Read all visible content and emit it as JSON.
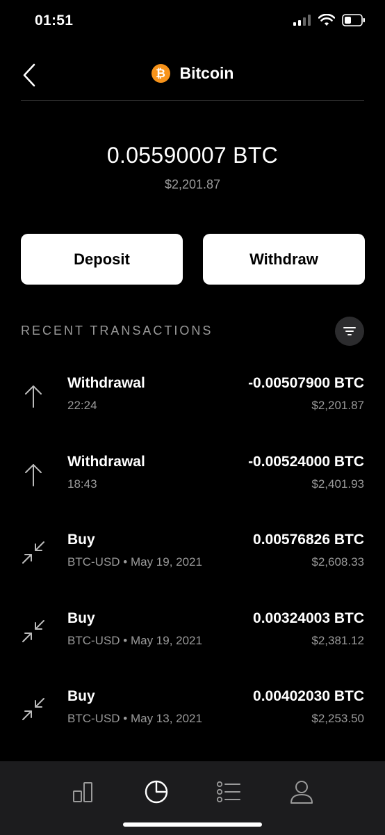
{
  "status": {
    "time": "01:51"
  },
  "header": {
    "title": "Bitcoin",
    "coin_symbol": "₿"
  },
  "balance": {
    "btc": "0.05590007 BTC",
    "usd": "$2,201.87"
  },
  "actions": {
    "deposit_label": "Deposit",
    "withdraw_label": "Withdraw"
  },
  "recent": {
    "title": "RECENT TRANSACTIONS",
    "items": [
      {
        "type": "Withdrawal",
        "sub": "22:24",
        "amount": "-0.00507900 BTC",
        "usd": "$2,201.87",
        "icon": "arrow-up-icon"
      },
      {
        "type": "Withdrawal",
        "sub": "18:43",
        "amount": "-0.00524000 BTC",
        "usd": "$2,401.93",
        "icon": "arrow-up-icon"
      },
      {
        "type": "Buy",
        "sub": "BTC-USD • May 19, 2021",
        "amount": "0.00576826 BTC",
        "usd": "$2,608.33",
        "icon": "buy-arrows-icon"
      },
      {
        "type": "Buy",
        "sub": "BTC-USD • May 19, 2021",
        "amount": "0.00324003 BTC",
        "usd": "$2,381.12",
        "icon": "buy-arrows-icon"
      },
      {
        "type": "Buy",
        "sub": "BTC-USD • May 13, 2021",
        "amount": "0.00402030 BTC",
        "usd": "$2,253.50",
        "icon": "buy-arrows-icon"
      }
    ]
  },
  "tabs": [
    "chart-icon",
    "portfolio-icon",
    "list-icon",
    "profile-icon"
  ],
  "colors": {
    "accent": "#f7931a",
    "background": "#000000",
    "muted": "#9a9a9a",
    "tabbar": "#1c1c1e"
  }
}
